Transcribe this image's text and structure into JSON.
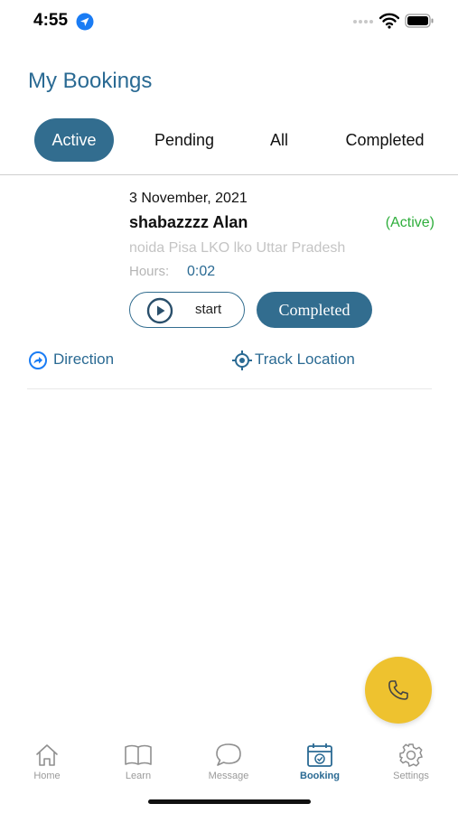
{
  "status_bar": {
    "time": "4:55"
  },
  "header": {
    "title": "My Bookings"
  },
  "tabs": [
    {
      "label": "Active",
      "selected": true
    },
    {
      "label": "Pending",
      "selected": false
    },
    {
      "label": "All",
      "selected": false
    },
    {
      "label": "Completed",
      "selected": false
    }
  ],
  "booking": {
    "date": "3 November, 2021",
    "name": "shabazzzz Alan",
    "status": "(Active)",
    "address": "noida Pisa LKO lko Uttar Pradesh",
    "hours_label": "Hours:",
    "hours_value": "0:02",
    "start_label": "start",
    "completed_label": "Completed",
    "direction_label": "Direction",
    "track_label": "Track Location"
  },
  "fab": {
    "icon": "phone-icon"
  },
  "bottom_nav": [
    {
      "label": "Home",
      "icon": "home-icon",
      "active": false
    },
    {
      "label": "Learn",
      "icon": "book-icon",
      "active": false
    },
    {
      "label": "Message",
      "icon": "chat-bubble-icon",
      "active": false
    },
    {
      "label": "Booking",
      "icon": "calendar-check-icon",
      "active": true
    },
    {
      "label": "Settings",
      "icon": "gear-icon",
      "active": false
    }
  ],
  "colors": {
    "primary": "#326d8f",
    "accent_text": "#2a6a93",
    "active_status": "#2fae3c",
    "fab": "#eec22f"
  }
}
